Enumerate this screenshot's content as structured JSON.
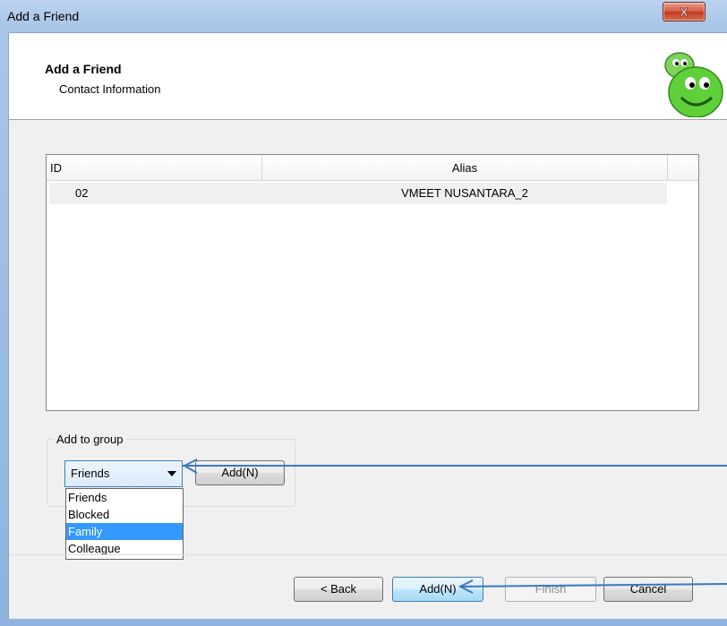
{
  "window": {
    "title": "Add a Friend",
    "close_label": "X"
  },
  "header": {
    "title": "Add a Friend",
    "subtitle": "Contact Information",
    "logo_icon": "smiley-mascot-icon"
  },
  "list": {
    "columns": [
      "ID",
      "Alias"
    ],
    "rows": [
      {
        "id": "02",
        "alias": "VMEET NUSANTARA_2"
      }
    ]
  },
  "group": {
    "label": "Add to group",
    "selected": "Friends",
    "options": [
      "Friends",
      "Blocked",
      "Family",
      "Colleague"
    ],
    "highlighted": "Family",
    "add_label": "Add(N)"
  },
  "footer": {
    "back_label": "< Back",
    "add_label": "Add(N)",
    "finish_label": "Finish",
    "cancel_label": "Cancel"
  },
  "colors": {
    "accent": "#3399ff",
    "annotation": "#3a78c0"
  }
}
